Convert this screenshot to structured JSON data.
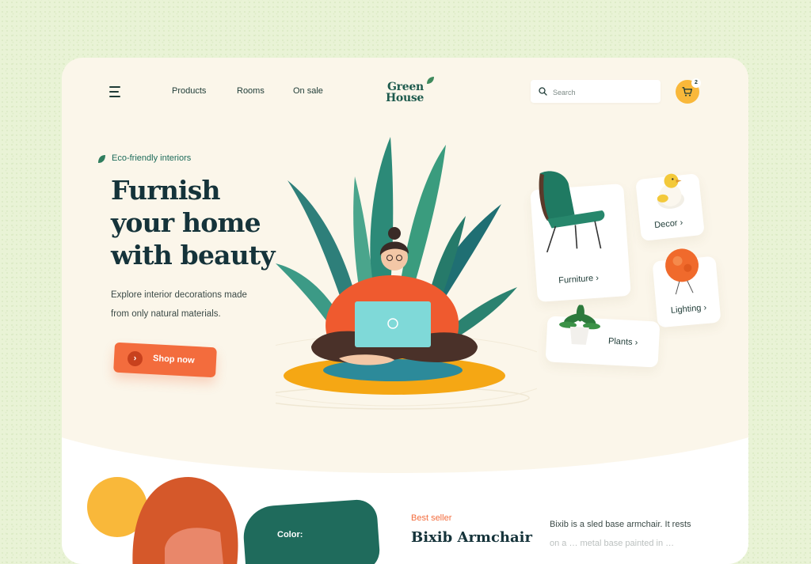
{
  "nav": {
    "links": [
      "Products",
      "Rooms",
      "On sale"
    ],
    "logo_line1": "Green",
    "logo_line2": "House",
    "search_placeholder": "Search",
    "cart_count": "2"
  },
  "hero": {
    "tag": "Eco-friendly interiors",
    "headline": [
      "Furnish",
      "your home",
      "with beauty"
    ],
    "subtext": [
      "Explore interior decorations made",
      "from only natural materials."
    ],
    "cta": "Shop now"
  },
  "categories": {
    "furniture": "Furniture ›",
    "decor": "Decor ›",
    "lighting": "Lighting ›",
    "plants": "Plants ›"
  },
  "product": {
    "badge": "Best seller",
    "title": "Bixib Armchair",
    "color_label": "Color:",
    "description": [
      "Bixib is a sled base armchair. It rests",
      "on a … metal base painted in …"
    ]
  },
  "colors": {
    "accent": "#f36c3d",
    "primary": "#1d5a4d",
    "yellow": "#f9b83a",
    "card_bg": "#fbf6ea",
    "page_bg": "#e9f3d6"
  }
}
